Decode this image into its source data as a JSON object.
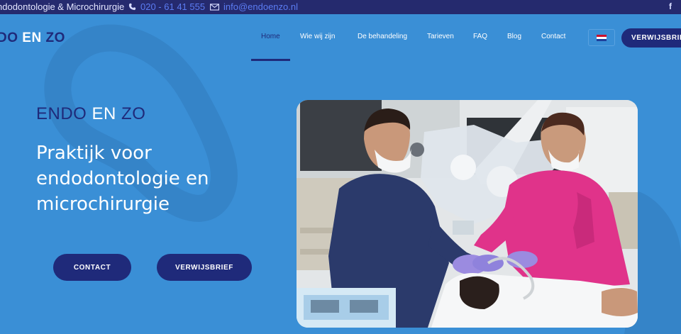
{
  "topbar": {
    "tagline": "ndodontologie & Microchirurgie",
    "phone": "020 - 61 41 555",
    "email": "info@endoenzo.nl",
    "facebook_glyph": "f"
  },
  "logo": {
    "part1": "DO ",
    "part2": "EN",
    "part3": " ZO"
  },
  "nav": {
    "items": [
      {
        "label": "Home"
      },
      {
        "label": "Wie wij zijn"
      },
      {
        "label": "De behandeling"
      },
      {
        "label": "Tarieven"
      },
      {
        "label": "FAQ"
      },
      {
        "label": "Blog"
      },
      {
        "label": "Contact"
      }
    ],
    "active_index": 0,
    "language_icon": "dutch-flag-icon",
    "cta_label": "VERWIJSBRIEF"
  },
  "hero": {
    "brand_part1": "ENDO ",
    "brand_part2": "EN",
    "brand_part3": " ZO",
    "headline": "Praktijk voor endodontologie en microchirurgie",
    "contact_label": "CONTACT",
    "referral_label": "VERWIJSBRIEF",
    "photo_icon": "dental-surgery-photo"
  },
  "colors": {
    "background": "#3a8fd6",
    "navy": "#1f2a7a",
    "topbar": "#252a6e",
    "link_blue": "#5b7cf2"
  }
}
